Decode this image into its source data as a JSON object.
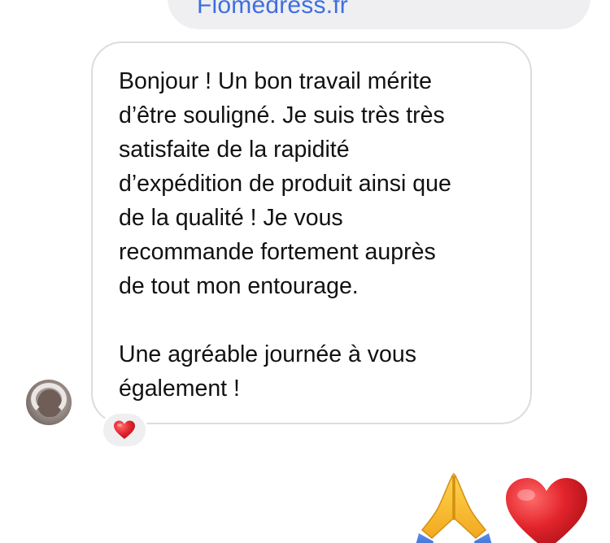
{
  "top_message": {
    "link_text": "Flomedress.fr"
  },
  "incoming_message": {
    "paragraphs": [
      "Bonjour ! Un bon travail mérite\nd’être souligné. Je suis très très\nsatisfaite de la rapidité\nd’expédition de produit ainsi que\nde la qualité ! Je vous\nrecommande fortement auprès\nde tout mon entourage.",
      "Une agréable journée à vous\négalement !"
    ],
    "reaction_icon": "red-heart-icon"
  },
  "outgoing_emojis": [
    "folded-hands-icon",
    "red-heart-icon"
  ],
  "colors": {
    "bubble_outline": "#dcdce0",
    "outgoing_bubble": "#efeff1",
    "link": "#3e6ee0",
    "heart": "#e0242c",
    "pray": "#f5b82a"
  }
}
